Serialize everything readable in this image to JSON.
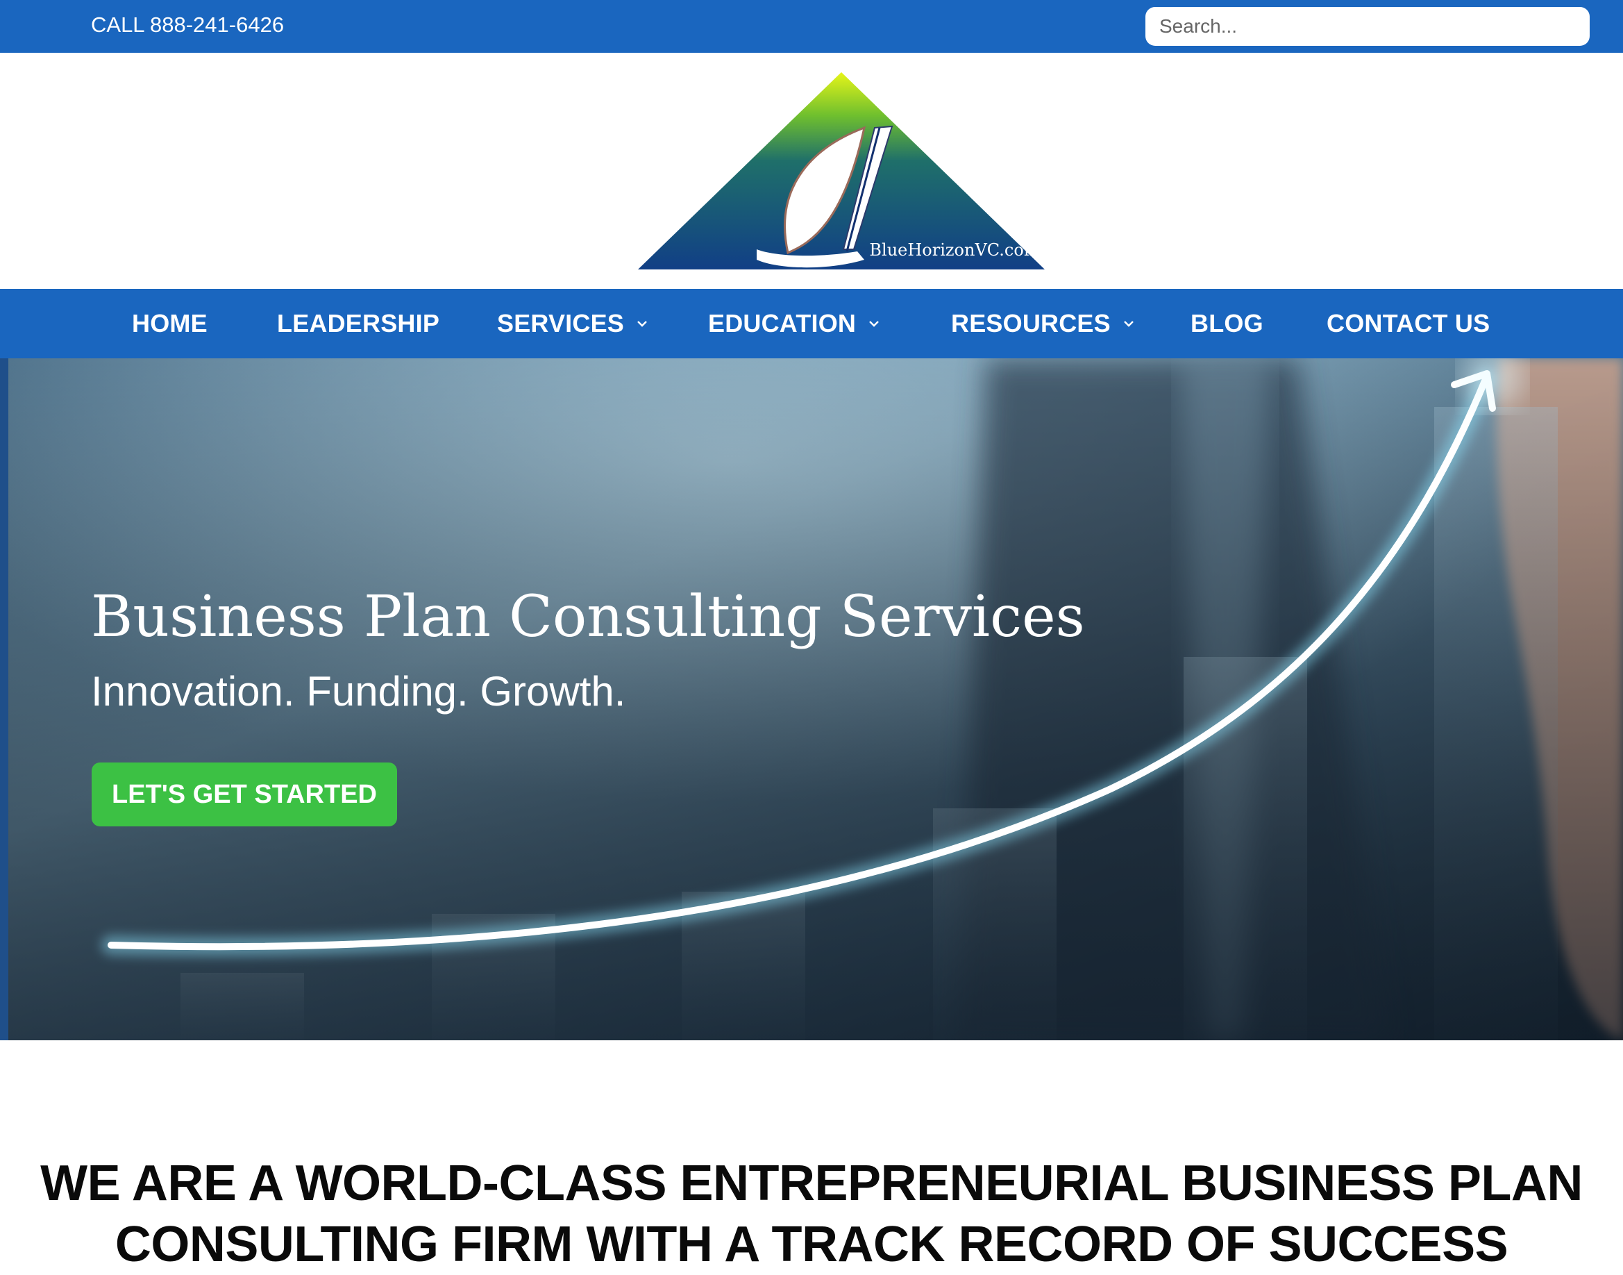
{
  "topbar": {
    "phone": "CALL 888-241-6426",
    "search_placeholder": "Search..."
  },
  "logo": {
    "text": "BlueHorizonVC.com",
    "icon": "sailboat-triangle-logo"
  },
  "nav": {
    "items": [
      {
        "label": "HOME",
        "dropdown": false
      },
      {
        "label": "LEADERSHIP",
        "dropdown": false
      },
      {
        "label": "SERVICES",
        "dropdown": true
      },
      {
        "label": "EDUCATION",
        "dropdown": true
      },
      {
        "label": "RESOURCES",
        "dropdown": true
      },
      {
        "label": "BLOG",
        "dropdown": false
      },
      {
        "label": "CONTACT US",
        "dropdown": false
      }
    ]
  },
  "hero": {
    "title": "Business Plan Consulting Services",
    "subtitle": "Innovation. Funding. Growth.",
    "cta_label": "LET'S GET STARTED"
  },
  "intro": {
    "headline_line1": "WE ARE A WORLD-CLASS ENTREPRENEURIAL BUSINESS PLAN",
    "headline_line2": "CONSULTING FIRM WITH A TRACK RECORD OF SUCCESS"
  },
  "colors": {
    "brand_blue": "#1a66bf",
    "cta_green": "#3cc144",
    "text_dark": "#0a0a0a"
  }
}
